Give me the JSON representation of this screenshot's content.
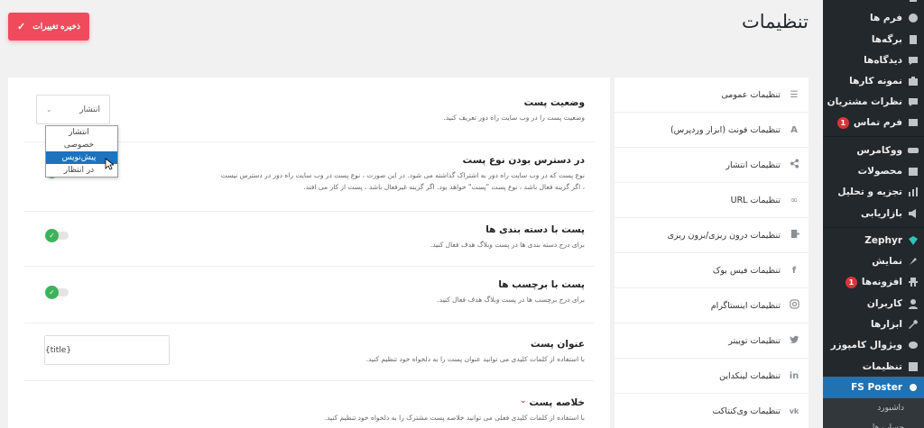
{
  "header": {
    "title": "تنظیمات",
    "save_label": "ذخیره تغییرات"
  },
  "sidebar": {
    "items": [
      {
        "label": "فرم ها",
        "icon": "forms-icon"
      },
      {
        "label": "برگه‌ها",
        "icon": "pages-icon"
      },
      {
        "label": "دیدگاه‌ها",
        "icon": "comments-icon"
      },
      {
        "label": "نمونه کارها",
        "icon": "portfolio-icon"
      },
      {
        "label": "نظرات مشتریان",
        "icon": "testimonials-icon"
      },
      {
        "label": "فرم تماس",
        "icon": "mail-icon",
        "badge": "1"
      },
      {
        "label": "ووکامرس",
        "icon": "woocommerce-icon"
      },
      {
        "label": "محصولات",
        "icon": "products-icon"
      },
      {
        "label": "تجزیه و تحلیل",
        "icon": "analytics-icon"
      },
      {
        "label": "بازاریابی",
        "icon": "marketing-icon"
      },
      {
        "label": "Zephyr",
        "icon": "zephyr-icon"
      },
      {
        "label": "نمایش",
        "icon": "appearance-icon"
      },
      {
        "label": "افزونه‌ها",
        "icon": "plugins-icon",
        "badge": "1"
      },
      {
        "label": "کاربران",
        "icon": "users-icon"
      },
      {
        "label": "ابزارها",
        "icon": "tools-icon"
      },
      {
        "label": "ویژوال کامپوزر",
        "icon": "visual-composer-icon"
      },
      {
        "label": "تنظیمات",
        "icon": "settings-icon"
      },
      {
        "label": "FS Poster",
        "icon": "fs-poster-icon"
      }
    ],
    "submenu": [
      {
        "label": "داشبورد"
      },
      {
        "label": "حساب ها"
      }
    ]
  },
  "settings_nav": [
    {
      "label": "تنظیمات عمومی",
      "icon": "list-icon"
    },
    {
      "label": "تنظیمات فونت (ابزار وردپرس)",
      "icon": "font-icon"
    },
    {
      "label": "تنظیمات انتشار",
      "icon": "share-icon"
    },
    {
      "label": "تنظیمات URL",
      "icon": "link-icon"
    },
    {
      "label": "تنظیمات درون ریزی/برون ریزی",
      "icon": "import-export-icon"
    },
    {
      "label": "تنظیمات فیس بوک",
      "icon": "facebook-icon"
    },
    {
      "label": "تنظیمات اینستاگرام",
      "icon": "instagram-icon"
    },
    {
      "label": "تنظیمات توییتر",
      "icon": "twitter-icon"
    },
    {
      "label": "تنظیمات لینکداین",
      "icon": "linkedin-icon"
    },
    {
      "label": "تنظیمات وی‌کنتاکت",
      "icon": "vk-icon"
    }
  ],
  "main": {
    "post_status": {
      "title": "وضعیت پست",
      "desc": "وضعیت پست را در وب سایت راه دور تعریف کنید.",
      "selected": "انتشار",
      "options": [
        "انتشار",
        "خصوصی",
        "پیش‌نویس",
        "در انتظار"
      ],
      "highlighted": "پیش‌نویس"
    },
    "post_type_access": {
      "title": "در دسترس بودن نوع پست",
      "desc_line1": "نوع پست که در وب سایت راه دور به اشتراک گذاشته می شود. در این صورت ، نوع پست در وب سایت راه دور در دسترس نیست",
      "desc_line2": "، اگر گزینه فعال باشد ، نوع پست \"پست\" خواهد بود. اگر گزینه غیرفعال باشد ، پست از کار می افتد."
    },
    "post_categories": {
      "title": "پست با دسته بندی ها",
      "desc": "برای درج دسته بندی ها در پست وبلاگ هدف فعال کنید."
    },
    "post_tags": {
      "title": "پست با برچسب ها",
      "desc": "برای درج برچسب ها در پست وبلاگ هدف فعال کنید."
    },
    "post_title": {
      "title": "عنوان پست",
      "desc": "با استفاده از کلمات کلیدی می توانید عنوان پست را به دلخواه خود تنظیم کنید.",
      "value": "{title}"
    },
    "post_excerpt": {
      "title": "خلاصه پست",
      "desc": "با استفاده از کلمات کلیدی فعلی می توانید خلاصه پست مشترک را به دلخواه خود تنظیم کنید."
    }
  },
  "colors": {
    "save_button": "#f04b5d",
    "toggle_on": "#3db25a",
    "sidebar_bg": "#23282d",
    "sidebar_active": "#2271b1"
  }
}
